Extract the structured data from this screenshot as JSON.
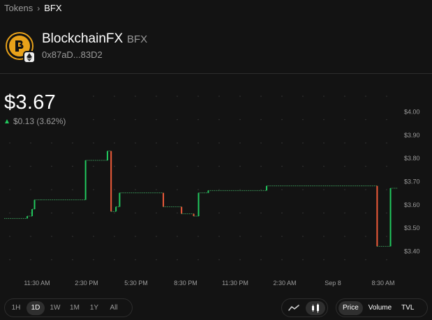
{
  "breadcrumb": {
    "parent": "Tokens",
    "separator": "›",
    "current": "BFX"
  },
  "token": {
    "name": "BlockchainFX",
    "symbol": "BFX",
    "address": "0x87aD...83D2",
    "logo_icon": "blockchainfx-logo-icon",
    "chain_icon": "ethereum-icon",
    "brand_color": "#e8a21a"
  },
  "price": {
    "current": "$3.67",
    "change": "$0.13 (3.62%)",
    "direction": "up",
    "up_color": "#21c95e",
    "down_color": "#ef5b3a"
  },
  "chart_data": {
    "type": "candlestick-step",
    "ylim": [
      3.38,
      4.03
    ],
    "ylabels": [
      "$4.00",
      "$3.90",
      "$3.80",
      "$3.70",
      "$3.60",
      "$3.50",
      "$3.40"
    ],
    "yticks": [
      4.0,
      3.9,
      3.8,
      3.7,
      3.6,
      3.5,
      3.4
    ],
    "xlabels": [
      "11:30 AM",
      "2:30 PM",
      "5:30 PM",
      "8:30 PM",
      "11:30 PM",
      "2:30 AM",
      "Sep 8",
      "8:30 AM"
    ],
    "x_start": "10:00 AM",
    "x_end": "9:30 AM",
    "grid": "dotted",
    "series": [
      {
        "x": 0.0,
        "open": 3.54,
        "close": 3.54
      },
      {
        "x": 0.7,
        "open": 3.54,
        "close": 3.54
      },
      {
        "x": 0.95,
        "open": 3.54,
        "close": 3.55
      },
      {
        "x": 1.15,
        "open": 3.55,
        "close": 3.58
      },
      {
        "x": 1.25,
        "open": 3.58,
        "close": 3.62
      },
      {
        "x": 1.5,
        "open": 3.62,
        "close": 3.62
      },
      {
        "x": 3.35,
        "open": 3.62,
        "close": 3.79
      },
      {
        "x": 4.25,
        "open": 3.79,
        "close": 3.83
      },
      {
        "x": 4.4,
        "open": 3.83,
        "close": 3.57
      },
      {
        "x": 4.6,
        "open": 3.57,
        "close": 3.59
      },
      {
        "x": 4.75,
        "open": 3.59,
        "close": 3.65
      },
      {
        "x": 6.55,
        "open": 3.65,
        "close": 3.59
      },
      {
        "x": 7.3,
        "open": 3.59,
        "close": 3.56
      },
      {
        "x": 7.8,
        "open": 3.56,
        "close": 3.55
      },
      {
        "x": 8.0,
        "open": 3.55,
        "close": 3.65
      },
      {
        "x": 8.4,
        "open": 3.65,
        "close": 3.66
      },
      {
        "x": 10.8,
        "open": 3.66,
        "close": 3.68
      },
      {
        "x": 15.35,
        "open": 3.68,
        "close": 3.42
      },
      {
        "x": 15.9,
        "open": 3.42,
        "close": 3.67
      },
      {
        "x": 16.2,
        "open": 3.67,
        "close": 3.67
      }
    ]
  },
  "range_options": [
    {
      "label": "1H",
      "active": false
    },
    {
      "label": "1D",
      "active": true
    },
    {
      "label": "1W",
      "active": false
    },
    {
      "label": "1M",
      "active": false
    },
    {
      "label": "1Y",
      "active": false
    },
    {
      "label": "All",
      "active": false
    }
  ],
  "chart_type_options": [
    {
      "icon": "line-chart-icon",
      "active": false
    },
    {
      "icon": "candlestick-chart-icon",
      "active": true
    }
  ],
  "metric_options": [
    {
      "label": "Price",
      "active": true
    },
    {
      "label": "Volume",
      "active": false
    },
    {
      "label": "TVL",
      "active": false
    }
  ]
}
